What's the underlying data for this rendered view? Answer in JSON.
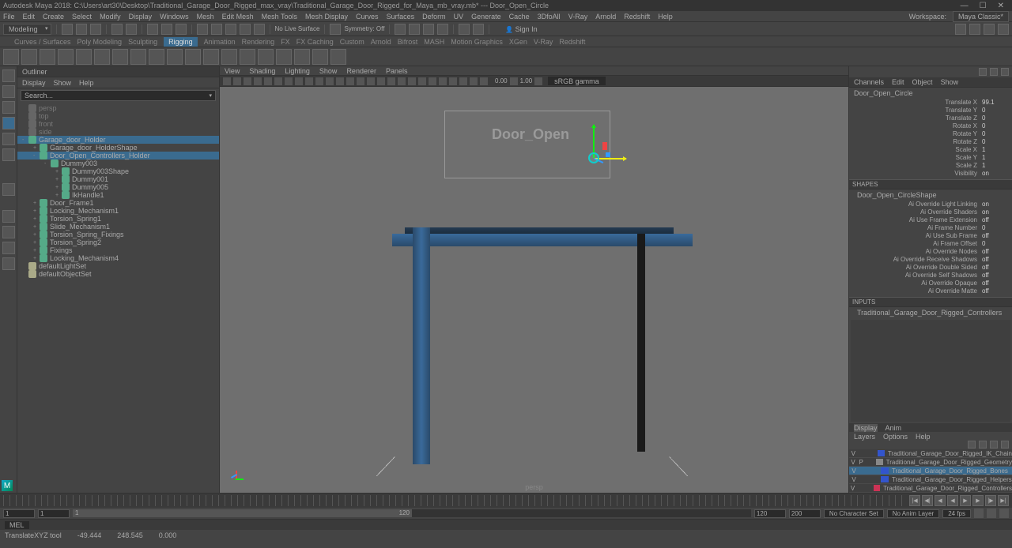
{
  "title": "Autodesk Maya 2018: C:\\Users\\art30\\Desktop\\Traditional_Garage_Door_Rigged_max_vray\\Traditional_Garage_Door_Rigged_for_Maya_mb_vray.mb*   ---   Door_Open_Circle",
  "menubar": [
    "File",
    "Edit",
    "Create",
    "Select",
    "Modify",
    "Display",
    "Windows",
    "Mesh",
    "Edit Mesh",
    "Mesh Tools",
    "Mesh Display",
    "Curves",
    "Surfaces",
    "Deform",
    "UV",
    "Generate",
    "Cache",
    "3DfoAll",
    "V-Ray",
    "Arnold",
    "Redshift",
    "Help"
  ],
  "workspace_label": "Workspace:",
  "workspace_value": "Maya Classic*",
  "modeling_combo": "Modeling",
  "sym_label": "Symmetry: Off",
  "nolive": "No Live Surface",
  "signin": "Sign In",
  "shelftabs": [
    "Curves / Surfaces",
    "Poly Modeling",
    "Sculpting",
    "Rigging",
    "Animation",
    "Rendering",
    "FX",
    "FX Caching",
    "Custom",
    "Arnold",
    "Bifrost",
    "MASH",
    "Motion Graphics",
    "XGen",
    "V-Ray",
    "Redshift"
  ],
  "shelftab_active": "Rigging",
  "outliner": {
    "title": "Outliner",
    "menu": [
      "Display",
      "Show",
      "Help"
    ],
    "search": "Search..."
  },
  "tree": [
    {
      "ind": 0,
      "label": "persp",
      "ic": "grp",
      "dim": 1
    },
    {
      "ind": 0,
      "label": "top",
      "ic": "grp",
      "dim": 1
    },
    {
      "ind": 0,
      "label": "front",
      "ic": "grp",
      "dim": 1
    },
    {
      "ind": 0,
      "label": "side",
      "ic": "grp",
      "dim": 1
    },
    {
      "ind": 0,
      "label": "Garage_door_Holder",
      "tog": "-",
      "sel": 1
    },
    {
      "ind": 1,
      "label": "Garage_door_HolderShape",
      "tog": "+"
    },
    {
      "ind": 1,
      "label": "Door_Open_Controllers_Holder",
      "tog": "-",
      "sel": 1
    },
    {
      "ind": 2,
      "label": "Dummy003",
      "tog": "-"
    },
    {
      "ind": 3,
      "label": "Dummy003Shape",
      "tog": "+"
    },
    {
      "ind": 3,
      "label": "Dummy001",
      "tog": "+"
    },
    {
      "ind": 3,
      "label": "Dummy005",
      "tog": "+"
    },
    {
      "ind": 3,
      "label": "IkHandle1",
      "tog": "+"
    },
    {
      "ind": 1,
      "label": "Door_Frame1",
      "tog": "+"
    },
    {
      "ind": 1,
      "label": "Locking_Mechanism1",
      "tog": "+"
    },
    {
      "ind": 1,
      "label": "Torsion_Spring1",
      "tog": "+"
    },
    {
      "ind": 1,
      "label": "Slide_Mechanism1",
      "tog": "+"
    },
    {
      "ind": 1,
      "label": "Torsion_Spring_Fixings",
      "tog": "+"
    },
    {
      "ind": 1,
      "label": "Torsion_Spring2",
      "tog": "+"
    },
    {
      "ind": 1,
      "label": "Fixings",
      "tog": "+"
    },
    {
      "ind": 1,
      "label": "Locking_Mechanism4",
      "tog": "+"
    },
    {
      "ind": 0,
      "label": "defaultLightSet",
      "ic": "lgt"
    },
    {
      "ind": 0,
      "label": "defaultObjectSet",
      "ic": "lgt"
    }
  ],
  "vpmenu": [
    "View",
    "Shading",
    "Lighting",
    "Show",
    "Renderer",
    "Panels"
  ],
  "vp_gamma": "sRGB gamma",
  "vp_time": "0.00",
  "vp_frame": "1.00",
  "door_text": "Door_Open",
  "persp": "persp",
  "channel_tabs": [
    "Channels",
    "Edit",
    "Object",
    "Show"
  ],
  "channel_obj": "Door_Open_Circle",
  "transforms": [
    {
      "k": "Translate X",
      "v": "99.1"
    },
    {
      "k": "Translate Y",
      "v": "0"
    },
    {
      "k": "Translate Z",
      "v": "0"
    },
    {
      "k": "Rotate X",
      "v": "0"
    },
    {
      "k": "Rotate Y",
      "v": "0"
    },
    {
      "k": "Rotate Z",
      "v": "0"
    },
    {
      "k": "Scale X",
      "v": "1"
    },
    {
      "k": "Scale Y",
      "v": "1"
    },
    {
      "k": "Scale Z",
      "v": "1"
    },
    {
      "k": "Visibility",
      "v": "on"
    }
  ],
  "shapes_head": "SHAPES",
  "shapes_sub": "Door_Open_CircleShape",
  "shape_attrs": [
    {
      "k": "Ai Override Light Linking",
      "v": "on"
    },
    {
      "k": "Ai Override Shaders",
      "v": "on"
    },
    {
      "k": "Ai Use Frame Extension",
      "v": "off"
    },
    {
      "k": "Ai Frame Number",
      "v": "0"
    },
    {
      "k": "Ai Use Sub Frame",
      "v": "off"
    },
    {
      "k": "Ai Frame Offset",
      "v": "0"
    },
    {
      "k": "Ai Override Nodes",
      "v": "off"
    },
    {
      "k": "Ai Override Receive Shadows",
      "v": "off"
    },
    {
      "k": "Ai Override Double Sided",
      "v": "off"
    },
    {
      "k": "Ai Override Self Shadows",
      "v": "off"
    },
    {
      "k": "Ai Override Opaque",
      "v": "off"
    },
    {
      "k": "Ai Override Matte",
      "v": "off"
    }
  ],
  "inputs_head": "INPUTS",
  "inputs_sub": "Traditional_Garage_Door_Rigged_Controllers",
  "layer_tabs": [
    "Display",
    "Anim"
  ],
  "layer_menu": [
    "Layers",
    "Options",
    "Help"
  ],
  "layers": [
    {
      "v": "V",
      "p": "",
      "c": "#3355cc",
      "n": "Traditional_Garage_Door_Rigged_IK_Chain"
    },
    {
      "v": "V",
      "p": "P",
      "c": "#888888",
      "n": "Traditional_Garage_Door_Rigged_Geometry"
    },
    {
      "v": "V",
      "p": "",
      "c": "#3355cc",
      "n": "Traditional_Garage_Door_Rigged_Bones",
      "sel": 1
    },
    {
      "v": "V",
      "p": "",
      "c": "#3355cc",
      "n": "Traditional_Garage_Door_Rigged_Helpers"
    },
    {
      "v": "V",
      "p": "",
      "c": "#cc3355",
      "n": "Traditional_Garage_Door_Rigged_Controllers"
    }
  ],
  "range": {
    "start": "1",
    "end": "200",
    "cur_start": "1",
    "cur_end": "120",
    "current": "1"
  },
  "charset": "No Character Set",
  "animlayer": "No Anim Layer",
  "fps": "24 fps",
  "mel": "MEL",
  "status": {
    "a": "TranslateXYZ tool",
    "b": "-49.444",
    "c": "248.545",
    "d": "0.000"
  }
}
